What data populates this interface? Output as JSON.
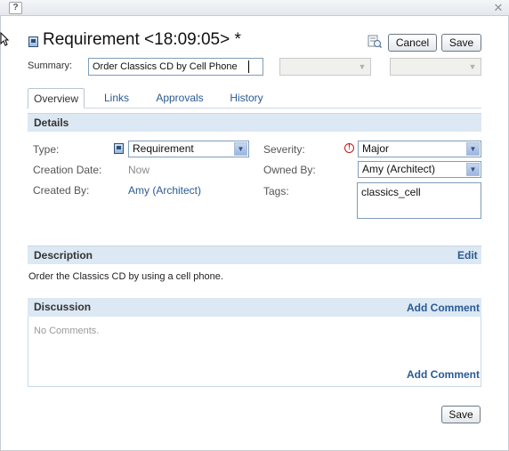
{
  "window": {
    "help_glyph": "?",
    "close_glyph": "✕"
  },
  "header": {
    "title": "Requirement <18:09:05> *",
    "cancel_label": "Cancel",
    "save_label": "Save"
  },
  "summary": {
    "label": "Summary:",
    "value": "Order Classics CD by Cell Phone"
  },
  "tabs": [
    {
      "label": "Overview",
      "active": true
    },
    {
      "label": "Links",
      "active": false
    },
    {
      "label": "Approvals",
      "active": false
    },
    {
      "label": "History",
      "active": false
    }
  ],
  "details": {
    "header": "Details",
    "type_label": "Type:",
    "type_value": "Requirement",
    "creation_date_label": "Creation Date:",
    "creation_date_value": "Now",
    "created_by_label": "Created By:",
    "created_by_value": "Amy (Architect)",
    "severity_label": "Severity:",
    "severity_value": "Major",
    "owned_by_label": "Owned By:",
    "owned_by_value": "Amy (Architect)",
    "tags_label": "Tags:",
    "tags_value": "classics_cell"
  },
  "description": {
    "header": "Description",
    "edit_label": "Edit",
    "text": "Order the Classics CD by using a cell phone."
  },
  "discussion": {
    "header": "Discussion",
    "add_comment_label": "Add Comment",
    "empty_text": "No Comments."
  },
  "footer": {
    "save_label": "Save"
  },
  "colors": {
    "link": "#2a5a93",
    "section_header_bg": "#dce8f3",
    "severity_icon": "#c41818"
  }
}
